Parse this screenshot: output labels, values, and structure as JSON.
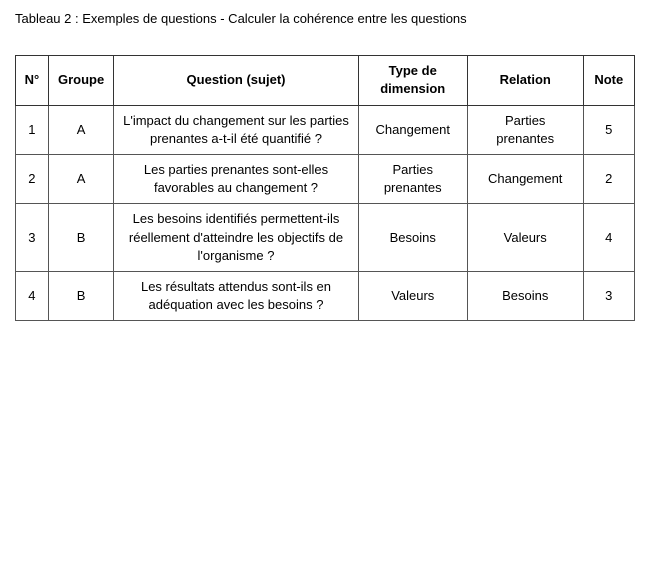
{
  "title": "Tableau 2 : Exemples de questions - Calculer la cohérence entre les questions",
  "table": {
    "headers": [
      {
        "key": "num",
        "label": "N°"
      },
      {
        "key": "group",
        "label": "Groupe"
      },
      {
        "key": "question",
        "label": "Question (sujet)"
      },
      {
        "key": "type",
        "label": "Type de dimension"
      },
      {
        "key": "relation",
        "label": "Relation"
      },
      {
        "key": "note",
        "label": "Note"
      }
    ],
    "rows": [
      {
        "num": "1",
        "group": "A",
        "question": "L'impact du changement sur les parties prenantes a-t-il été quantifié ?",
        "type": "Changement",
        "relation": "Parties prenantes",
        "note": "5"
      },
      {
        "num": "2",
        "group": "A",
        "question": "Les parties prenantes sont-elles favorables au changement ?",
        "type": "Parties prenantes",
        "relation": "Changement",
        "note": "2"
      },
      {
        "num": "3",
        "group": "B",
        "question": "Les besoins identifiés permettent-ils réellement d'atteindre les objectifs de l'organisme ?",
        "type": "Besoins",
        "relation": "Valeurs",
        "note": "4"
      },
      {
        "num": "4",
        "group": "B",
        "question": "Les résultats attendus sont-ils en adéquation avec les besoins ?",
        "type": "Valeurs",
        "relation": "Besoins",
        "note": "3"
      }
    ]
  }
}
